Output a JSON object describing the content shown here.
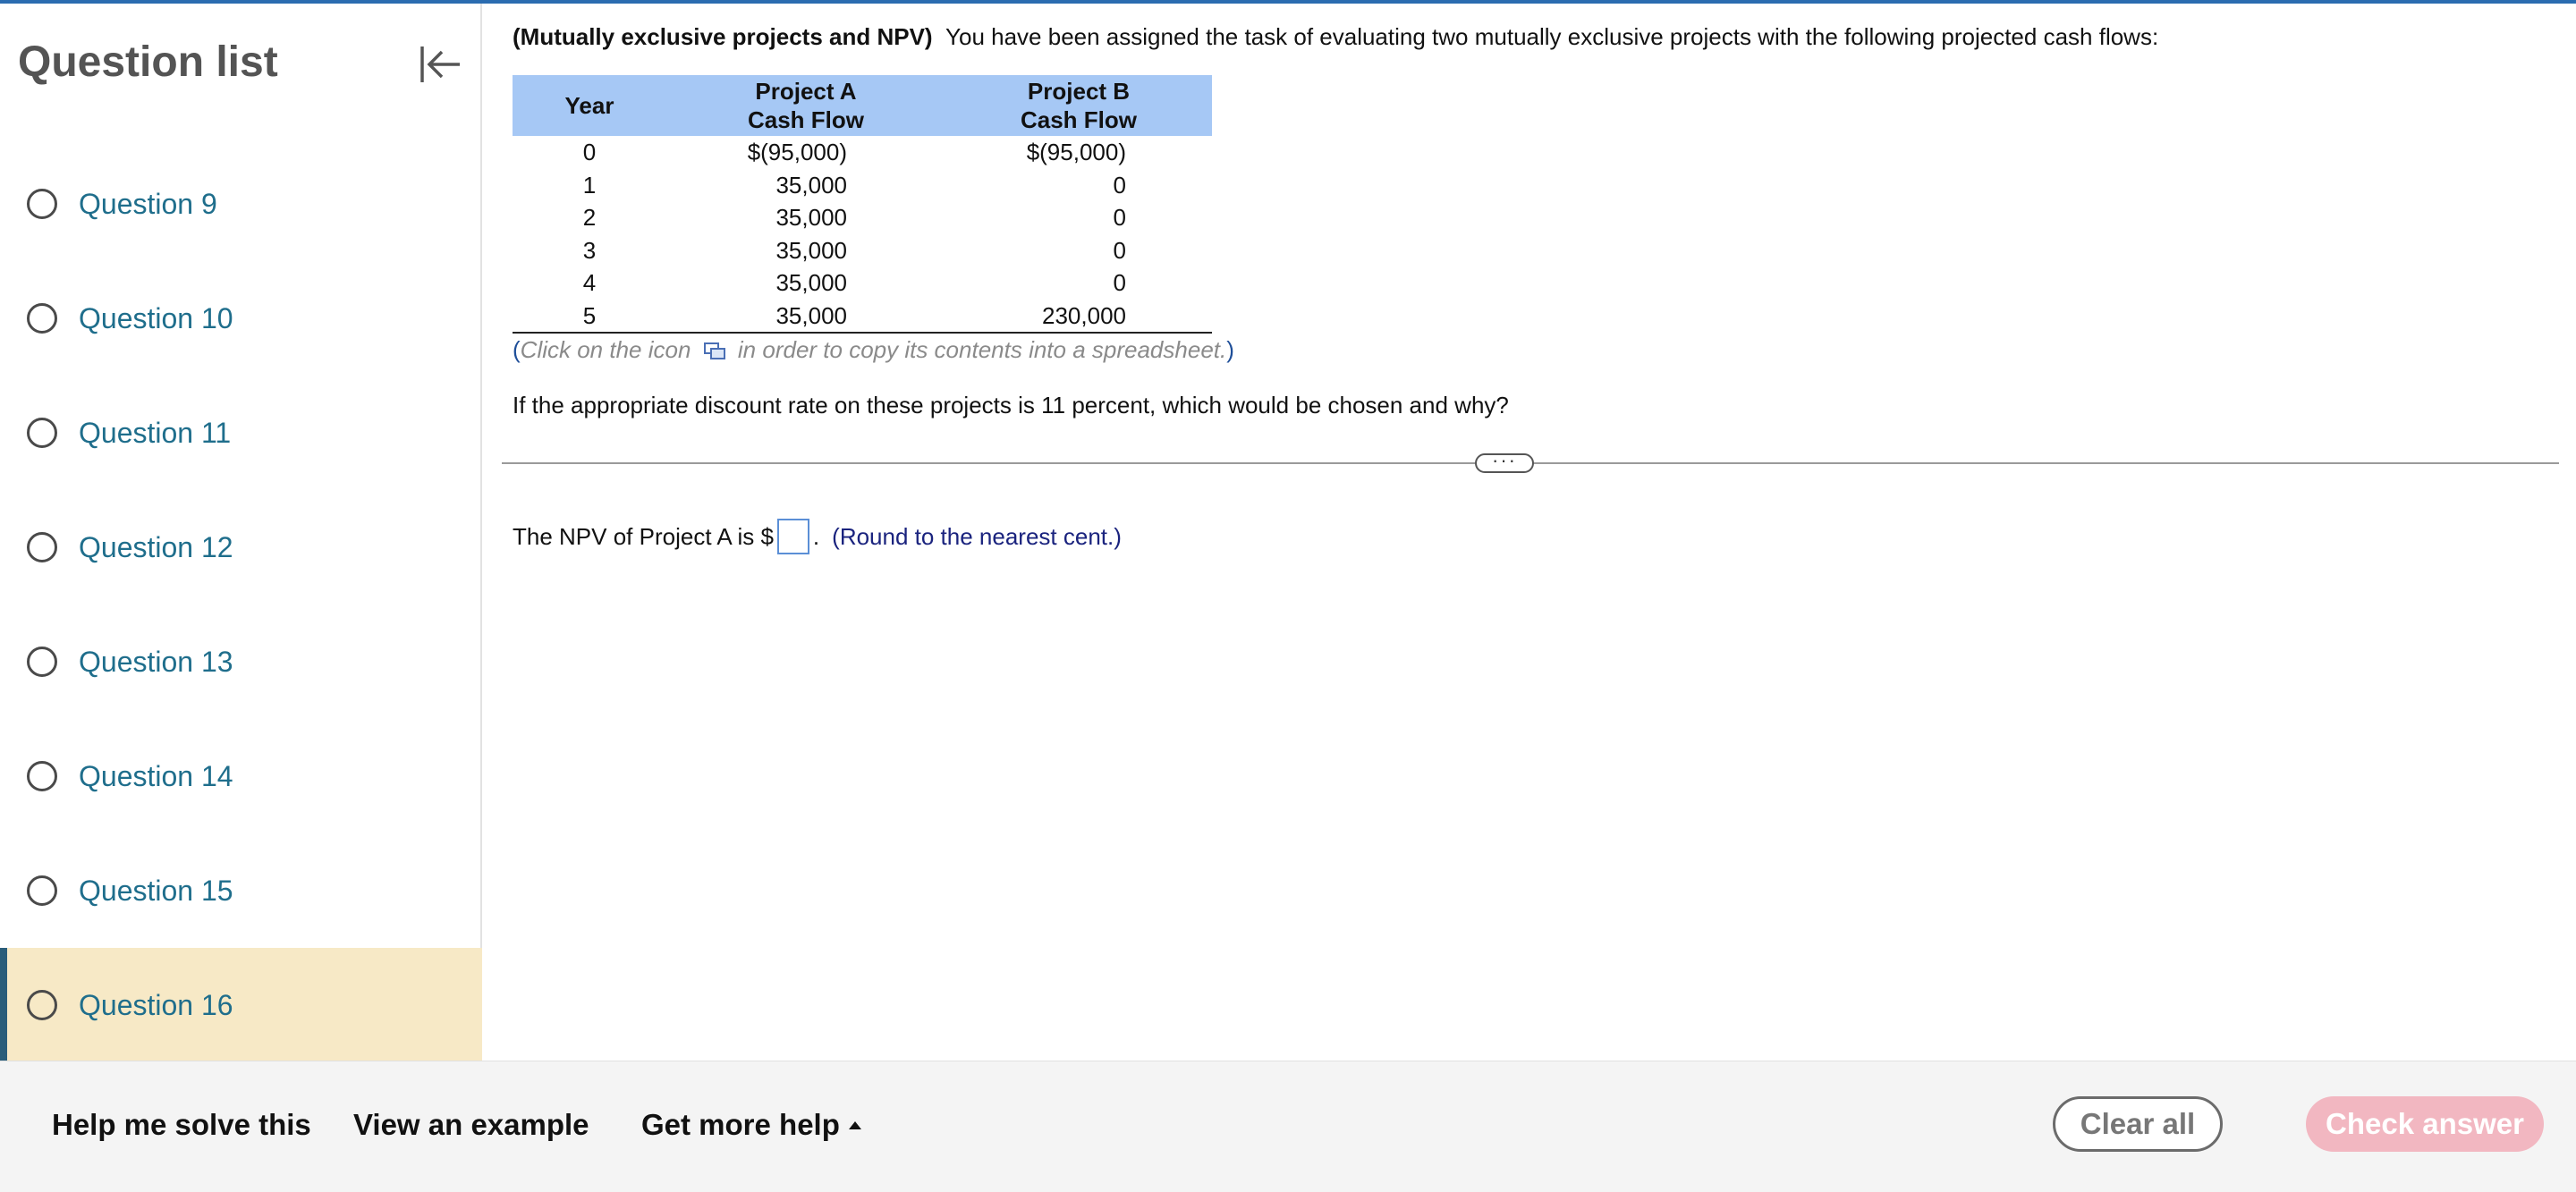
{
  "colors": {
    "accent": "#2b6cb0",
    "table_header": "#a6c8f5",
    "active_question_bg": "#f7e9c6",
    "question_link": "#1f6e8c",
    "check_button": "#f2b7c1"
  },
  "sidebar": {
    "title": "Question list",
    "collapse_icon": "collapse-left-icon",
    "items": [
      {
        "label": "Question 9",
        "active": false
      },
      {
        "label": "Question 10",
        "active": false
      },
      {
        "label": "Question 11",
        "active": false
      },
      {
        "label": "Question 12",
        "active": false
      },
      {
        "label": "Question 13",
        "active": false
      },
      {
        "label": "Question 14",
        "active": false
      },
      {
        "label": "Question 15",
        "active": false
      },
      {
        "label": "Question 16",
        "active": true
      }
    ]
  },
  "problem": {
    "title": "(Mutually exclusive projects and NPV)",
    "intro": "You have been assigned the task of evaluating two mutually exclusive projects with the following projected cash flows:",
    "table": {
      "headers": {
        "year": "Year",
        "a_line1": "Project A",
        "a_line2": "Cash Flow",
        "b_line1": "Project B",
        "b_line2": "Cash Flow"
      },
      "rows": [
        {
          "year": "0",
          "a": "$(95,000)",
          "b": "$(95,000)"
        },
        {
          "year": "1",
          "a": "35,000",
          "b": "0"
        },
        {
          "year": "2",
          "a": "35,000",
          "b": "0"
        },
        {
          "year": "3",
          "a": "35,000",
          "b": "0"
        },
        {
          "year": "4",
          "a": "35,000",
          "b": "0"
        },
        {
          "year": "5",
          "a": "35,000",
          "b": "230,000"
        }
      ]
    },
    "copy_note": {
      "open_paren": "(",
      "before_icon": "Click on the icon",
      "after_icon": "in order to copy its contents into a spreadsheet.",
      "close_paren": ")"
    },
    "question": "If the appropriate discount rate on these projects is 11 percent, which would be chosen and why?",
    "divider_handle": "···"
  },
  "answer": {
    "prefix": "The NPV of Project A is $",
    "value": "",
    "suffix": ".",
    "note": "(Round to the nearest cent.)"
  },
  "footer": {
    "help_solve": "Help me solve this",
    "view_example": "View an example",
    "more_help": "Get more help",
    "clear_all": "Clear all",
    "check_answer": "Check answer"
  }
}
